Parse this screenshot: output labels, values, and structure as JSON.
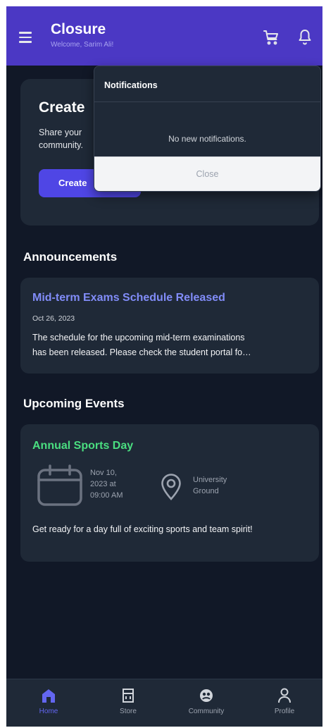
{
  "header": {
    "title": "Closure",
    "subtitle": "Welcome, Sarim Ali!",
    "menu_icon": "hamburger-menu-icon",
    "cart_icon": "cart-icon",
    "bell_icon": "bell-icon",
    "bg_color": "#4b38c4"
  },
  "create_card": {
    "title": "Create",
    "text_line1": "Share your",
    "text_line2": "community.",
    "button_label": "Create"
  },
  "notifications": {
    "title": "Notifications",
    "empty_text": "No new notifications.",
    "close_label": "Close"
  },
  "announcements": {
    "section_title": "Announcements",
    "items": [
      {
        "title": "Mid-term Exams Schedule Released",
        "date": "Oct 26, 2023",
        "body_line1": "The schedule for the upcoming mid-term examinations",
        "body_line2": "has been released. Please check the student portal fo…"
      }
    ]
  },
  "events": {
    "section_title": "Upcoming Events",
    "items": [
      {
        "title": "Annual Sports Day",
        "date_line1": "Nov 10,",
        "date_line2": "2023 at",
        "date_line3": "09:00 AM",
        "location_line1": "University",
        "location_line2": "Ground",
        "description": "Get ready for a day full of exciting sports and team spirit!"
      }
    ]
  },
  "bottom_nav": {
    "items": [
      {
        "label": "Home",
        "icon": "home-icon",
        "active": true
      },
      {
        "label": "Store",
        "icon": "store-icon",
        "active": false
      },
      {
        "label": "Community",
        "icon": "community-icon",
        "active": false
      },
      {
        "label": "Profile",
        "icon": "profile-icon",
        "active": false
      }
    ],
    "active_color": "#6366f1"
  }
}
